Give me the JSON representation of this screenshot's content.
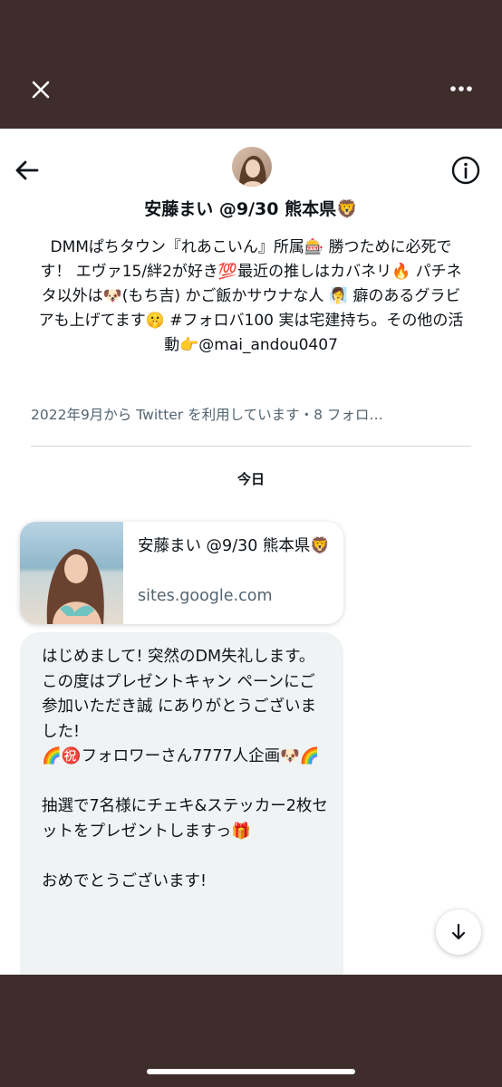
{
  "colors": {
    "frame_bg": "#3e2d2b",
    "sheet_bg": "#ffffff",
    "text_primary": "#0f1419",
    "text_secondary": "#536471",
    "bubble_bg": "#eff3f4"
  },
  "icons": {
    "close": "close-icon",
    "more": "more-horizontal-icon",
    "back": "arrow-left-icon",
    "info": "info-circle-icon",
    "scroll_down": "arrow-down-icon"
  },
  "profile": {
    "name": "安藤まい @9/30 熊本県🦁",
    "bio": "DMMぱちタウン『れあこいん』所属🎰 勝つために必死です！ エヴァ15/絆2が好き💯最近の推しはカバネリ🔥 パチネタ以外は🐶(もち吉) かご飯かサウナな人 🧖‍♀️ 癖のあるグラビアも上げてます🤫 #フォロバ100 実は宅建持ち。その他の活動👉@mai_andou0407",
    "meta": "2022年9月から Twitter を利用しています・8 フォロ…"
  },
  "conversation": {
    "day_label": "今日",
    "link_card": {
      "title": "安藤まい @9/30 熊本県🦁",
      "domain": "sites.google.com"
    },
    "message": "はじめまして! 突然のDM失礼します。\nこの度はプレゼントキャン ペーンにご参加いただき誠 にありがとうございました!\n🌈㊗️フォロワーさん7777人企画🐶🌈\n\n抽選で7名様にチェキ&ステッカー2枚セットをプレゼントしますっ🎁\n\nおめでとうございます!"
  }
}
